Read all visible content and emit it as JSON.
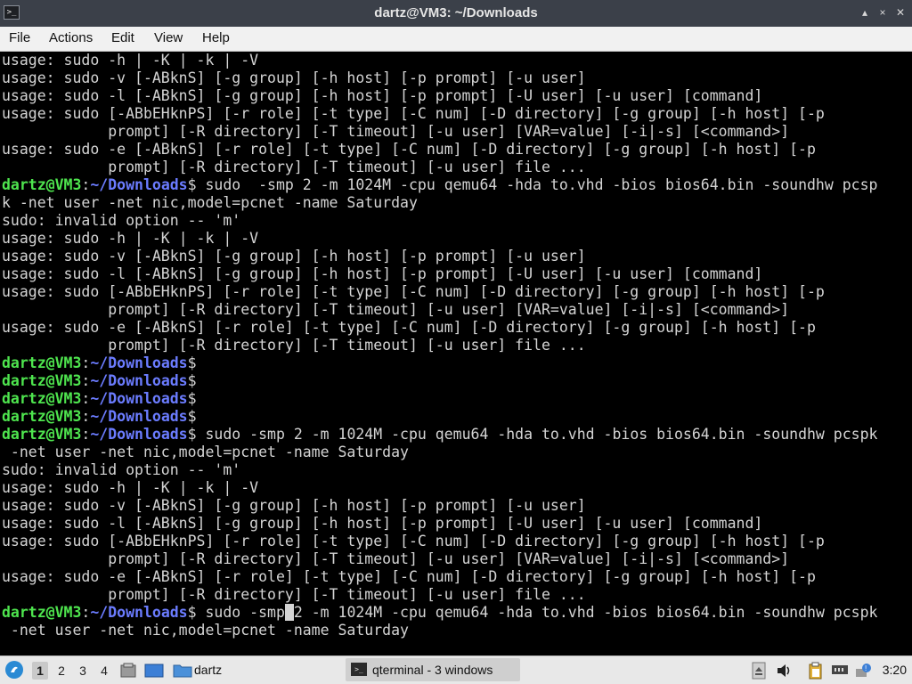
{
  "window": {
    "title": "dartz@VM3: ~/Downloads",
    "app_icon": ">_",
    "controls": {
      "minimize": "▴",
      "maximize": "×",
      "close": "✕"
    }
  },
  "menu": {
    "file": "File",
    "actions": "Actions",
    "edit": "Edit",
    "view": "View",
    "help": "Help"
  },
  "terminal": {
    "prompt_user": "dartz@VM3",
    "prompt_sep": ":",
    "prompt_path": "~/Downloads",
    "prompt_end": "$",
    "lines": [
      {
        "t": "out",
        "s": "usage: sudo -h | -K | -k | -V"
      },
      {
        "t": "out",
        "s": "usage: sudo -v [-ABknS] [-g group] [-h host] [-p prompt] [-u user]"
      },
      {
        "t": "out",
        "s": "usage: sudo -l [-ABknS] [-g group] [-h host] [-p prompt] [-U user] [-u user] [command]"
      },
      {
        "t": "out",
        "s": "usage: sudo [-ABbEHknPS] [-r role] [-t type] [-C num] [-D directory] [-g group] [-h host] [-p"
      },
      {
        "t": "out",
        "s": "            prompt] [-R directory] [-T timeout] [-u user] [VAR=value] [-i|-s] [<command>]"
      },
      {
        "t": "out",
        "s": "usage: sudo -e [-ABknS] [-r role] [-t type] [-C num] [-D directory] [-g group] [-h host] [-p"
      },
      {
        "t": "out",
        "s": "            prompt] [-R directory] [-T timeout] [-u user] file ..."
      },
      {
        "t": "cmd",
        "s": " sudo  -smp 2 -m 1024M -cpu qemu64 -hda to.vhd -bios bios64.bin -soundhw pcsp"
      },
      {
        "t": "out",
        "s": "k -net user -net nic,model=pcnet -name Saturday"
      },
      {
        "t": "out",
        "s": "sudo: invalid option -- 'm'"
      },
      {
        "t": "out",
        "s": "usage: sudo -h | -K | -k | -V"
      },
      {
        "t": "out",
        "s": "usage: sudo -v [-ABknS] [-g group] [-h host] [-p prompt] [-u user]"
      },
      {
        "t": "out",
        "s": "usage: sudo -l [-ABknS] [-g group] [-h host] [-p prompt] [-U user] [-u user] [command]"
      },
      {
        "t": "out",
        "s": "usage: sudo [-ABbEHknPS] [-r role] [-t type] [-C num] [-D directory] [-g group] [-h host] [-p"
      },
      {
        "t": "out",
        "s": "            prompt] [-R directory] [-T timeout] [-u user] [VAR=value] [-i|-s] [<command>]"
      },
      {
        "t": "out",
        "s": "usage: sudo -e [-ABknS] [-r role] [-t type] [-C num] [-D directory] [-g group] [-h host] [-p"
      },
      {
        "t": "out",
        "s": "            prompt] [-R directory] [-T timeout] [-u user] file ..."
      },
      {
        "t": "cmd",
        "s": ""
      },
      {
        "t": "cmd",
        "s": ""
      },
      {
        "t": "cmd",
        "s": ""
      },
      {
        "t": "cmd",
        "s": ""
      },
      {
        "t": "cmd",
        "s": " sudo -smp 2 -m 1024M -cpu qemu64 -hda to.vhd -bios bios64.bin -soundhw pcspk"
      },
      {
        "t": "out",
        "s": " -net user -net nic,model=pcnet -name Saturday"
      },
      {
        "t": "out",
        "s": "sudo: invalid option -- 'm'"
      },
      {
        "t": "out",
        "s": "usage: sudo -h | -K | -k | -V"
      },
      {
        "t": "out",
        "s": "usage: sudo -v [-ABknS] [-g group] [-h host] [-p prompt] [-u user]"
      },
      {
        "t": "out",
        "s": "usage: sudo -l [-ABknS] [-g group] [-h host] [-p prompt] [-U user] [-u user] [command]"
      },
      {
        "t": "out",
        "s": "usage: sudo [-ABbEHknPS] [-r role] [-t type] [-C num] [-D directory] [-g group] [-h host] [-p"
      },
      {
        "t": "out",
        "s": "            prompt] [-R directory] [-T timeout] [-u user] [VAR=value] [-i|-s] [<command>]"
      },
      {
        "t": "out",
        "s": "usage: sudo -e [-ABknS] [-r role] [-t type] [-C num] [-D directory] [-g group] [-h host] [-p"
      },
      {
        "t": "out",
        "s": "            prompt] [-R directory] [-T timeout] [-u user] file ..."
      },
      {
        "t": "cur",
        "before": " sudo -smp",
        "cursor": "",
        "after": "2 -m 1024M -cpu qemu64 -hda to.vhd -bios bios64.bin -soundhw pcspk"
      },
      {
        "t": "out",
        "s": " -net user -net nic,model=pcnet -name Saturday"
      }
    ]
  },
  "taskbar": {
    "start_icon": "start-menu-icon",
    "desktops": [
      "1",
      "2",
      "3",
      "4"
    ],
    "active_desktop": "1",
    "folder_label": "dartz",
    "task_label": "qterminal - 3 windows",
    "clock": "3:20"
  },
  "colors": {
    "prompt_user": "#4ee44e",
    "prompt_path": "#6b7cff",
    "terminal_bg": "#000000",
    "terminal_fg": "#d4d4d4"
  }
}
